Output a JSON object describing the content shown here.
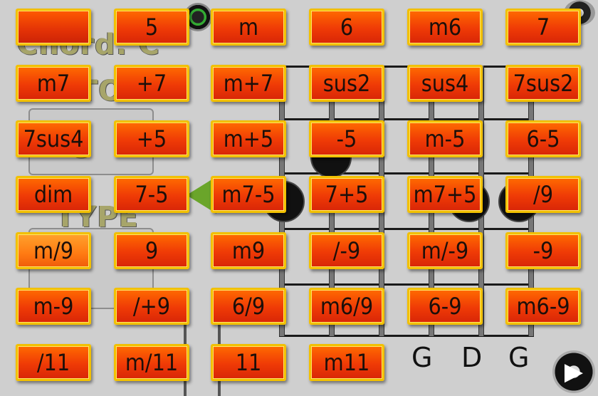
{
  "background": {
    "chord_label": "Chord: C",
    "tone_label": "TONE",
    "key_label": "G",
    "type_label": "TYPE",
    "tuning": [
      "G",
      "D",
      "G"
    ]
  },
  "chords": {
    "rows": [
      [
        "",
        "5",
        "m",
        "6",
        "m6",
        "7"
      ],
      [
        "m7",
        "+7",
        "m+7",
        "sus2",
        "sus4",
        "7sus2"
      ],
      [
        "7sus4",
        "+5",
        "m+5",
        "-5",
        "m-5",
        "6-5"
      ],
      [
        "dim",
        "7-5",
        "m7-5",
        "7+5",
        "m7+5",
        "/9"
      ],
      [
        "m/9",
        "9",
        "m9",
        "/-9",
        "m/-9",
        "-9"
      ],
      [
        "m-9",
        "/+9",
        "6/9",
        "m6/9",
        "6-9",
        "m6-9"
      ],
      [
        "/11",
        "m/11",
        "11",
        "m11"
      ]
    ],
    "selected": "m/9"
  },
  "icons": {
    "next": "play-next-icon",
    "speaker": "speaker-icon",
    "settings": "settings-icon"
  },
  "colors": {
    "button_fill": "#ef3a06",
    "button_border": "#f2c000",
    "selected_fill": "#ff7a12"
  }
}
